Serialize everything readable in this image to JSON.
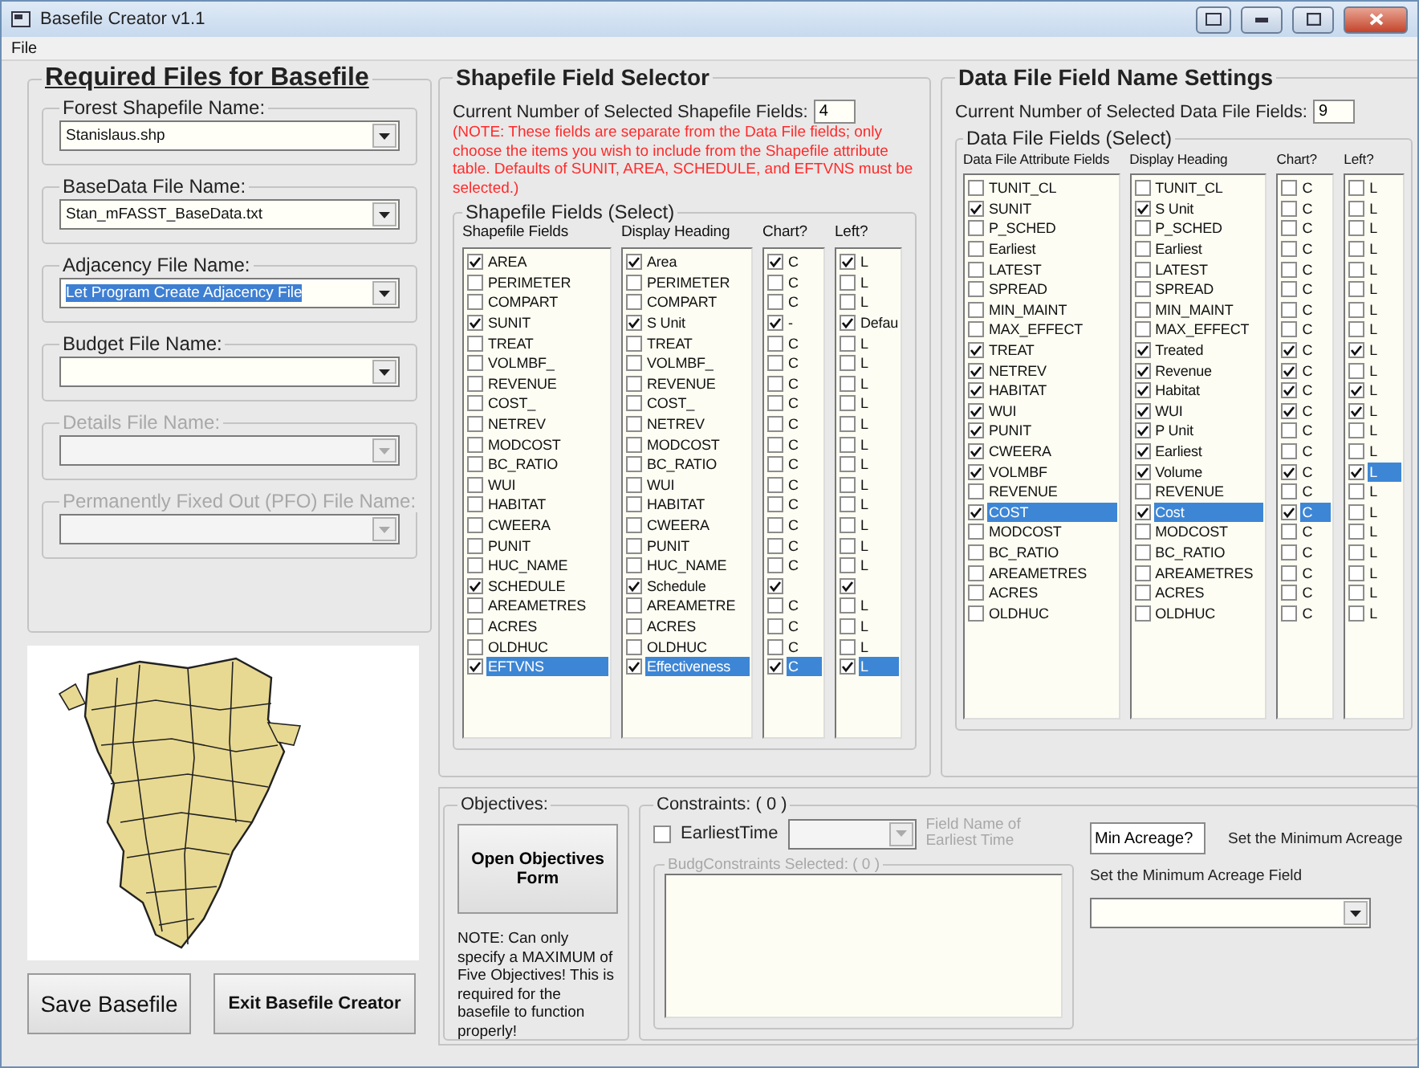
{
  "window": {
    "title": "Basefile Creator v1.1"
  },
  "menu": [
    "File"
  ],
  "required_files": {
    "title": "Required Files for Basefile",
    "fields": [
      {
        "label": "Forest Shapefile Name:",
        "value": "Stanislaus.shp",
        "disabled": false,
        "highlighted": false
      },
      {
        "label": "BaseData File Name:",
        "value": "Stan_mFASST_BaseData.txt",
        "disabled": false,
        "highlighted": false
      },
      {
        "label": "Adjacency File Name:",
        "value": "Let Program Create Adjacency File",
        "disabled": false,
        "highlighted": true
      },
      {
        "label": "Budget File Name:",
        "disabled": false
      },
      {
        "label": "Details File Name:",
        "disabled": true
      },
      {
        "label": "Permanently Fixed Out (PFO) File Name:",
        "disabled": true
      }
    ]
  },
  "buttons": [
    "Save Basefile",
    "Exit Basefile Creator"
  ],
  "shapefile_selector": {
    "title": "Shapefile Field Selector",
    "count_label": "Current Number of Selected Shapefile Fields:",
    "count": "4",
    "note": "(NOTE: These fields are separate from the Data File fields; only choose the items you wish to include from the Shapefile attribute table. Defaults of SUNIT, AREA, SCHEDULE, and EFTVNS must be selected.)",
    "group_title": "Shapefile Fields (Select)",
    "columns": [
      {
        "heading": "Shapefile Fields",
        "items": [
          {
            "text": "AREA",
            "checked": true,
            "selected": false
          },
          {
            "text": "PERIMETER",
            "checked": false,
            "selected": false
          },
          {
            "text": "COMPART",
            "checked": false,
            "selected": false
          },
          {
            "text": "SUNIT",
            "checked": true,
            "selected": false
          },
          {
            "text": "TREAT",
            "checked": false,
            "selected": false
          },
          {
            "text": "VOLMBF_",
            "checked": false,
            "selected": false
          },
          {
            "text": "REVENUE",
            "checked": false,
            "selected": false
          },
          {
            "text": "COST_",
            "checked": false,
            "selected": false
          },
          {
            "text": "NETREV",
            "checked": false,
            "selected": false
          },
          {
            "text": "MODCOST",
            "checked": false,
            "selected": false
          },
          {
            "text": "BC_RATIO",
            "checked": false,
            "selected": false
          },
          {
            "text": "WUI",
            "checked": false,
            "selected": false
          },
          {
            "text": "HABITAT",
            "checked": false,
            "selected": false
          },
          {
            "text": "CWEERA",
            "checked": false,
            "selected": false
          },
          {
            "text": "PUNIT",
            "checked": false,
            "selected": false
          },
          {
            "text": "HUC_NAME",
            "checked": false,
            "selected": false
          },
          {
            "text": "SCHEDULE",
            "checked": true,
            "selected": false
          },
          {
            "text": "AREAMETRES",
            "checked": false,
            "selected": false
          },
          {
            "text": "ACRES",
            "checked": false,
            "selected": false
          },
          {
            "text": "OLDHUC",
            "checked": false,
            "selected": false
          },
          {
            "text": "EFTVNS",
            "checked": true,
            "selected": true
          }
        ]
      },
      {
        "heading": "Display Heading",
        "items": [
          {
            "text": "Area",
            "checked": true,
            "selected": false
          },
          {
            "text": "PERIMETER",
            "checked": false,
            "selected": false
          },
          {
            "text": "COMPART",
            "checked": false,
            "selected": false
          },
          {
            "text": "S Unit",
            "checked": true,
            "selected": false
          },
          {
            "text": "TREAT",
            "checked": false,
            "selected": false
          },
          {
            "text": "VOLMBF_",
            "checked": false,
            "selected": false
          },
          {
            "text": "REVENUE",
            "checked": false,
            "selected": false
          },
          {
            "text": "COST_",
            "checked": false,
            "selected": false
          },
          {
            "text": "NETREV",
            "checked": false,
            "selected": false
          },
          {
            "text": "MODCOST",
            "checked": false,
            "selected": false
          },
          {
            "text": "BC_RATIO",
            "checked": false,
            "selected": false
          },
          {
            "text": "WUI",
            "checked": false,
            "selected": false
          },
          {
            "text": "HABITAT",
            "checked": false,
            "selected": false
          },
          {
            "text": "CWEERA",
            "checked": false,
            "selected": false
          },
          {
            "text": "PUNIT",
            "checked": false,
            "selected": false
          },
          {
            "text": "HUC_NAME",
            "checked": false,
            "selected": false
          },
          {
            "text": "Schedule",
            "checked": true,
            "selected": false
          },
          {
            "text": "AREAMETRE",
            "checked": false,
            "selected": false
          },
          {
            "text": "ACRES",
            "checked": false,
            "selected": false
          },
          {
            "text": "OLDHUC",
            "checked": false,
            "selected": false
          },
          {
            "text": "Effectiveness",
            "checked": true,
            "selected": true
          }
        ]
      },
      {
        "heading": "Chart?",
        "items": [
          {
            "text": "C",
            "checked": true,
            "selected": false
          },
          {
            "text": "C",
            "checked": false,
            "selected": false
          },
          {
            "text": "C",
            "checked": false,
            "selected": false
          },
          {
            "text": "-",
            "checked": true,
            "selected": false
          },
          {
            "text": "C",
            "checked": false,
            "selected": false
          },
          {
            "text": "C",
            "checked": false,
            "selected": false
          },
          {
            "text": "C",
            "checked": false,
            "selected": false
          },
          {
            "text": "C",
            "checked": false,
            "selected": false
          },
          {
            "text": "C",
            "checked": false,
            "selected": false
          },
          {
            "text": "C",
            "checked": false,
            "selected": false
          },
          {
            "text": "C",
            "checked": false,
            "selected": false
          },
          {
            "text": "C",
            "checked": false,
            "selected": false
          },
          {
            "text": "C",
            "checked": false,
            "selected": false
          },
          {
            "text": "C",
            "checked": false,
            "selected": false
          },
          {
            "text": "C",
            "checked": false,
            "selected": false
          },
          {
            "text": "C",
            "checked": false,
            "selected": false
          },
          {
            "checked": true
          },
          {
            "text": "C",
            "checked": false,
            "selected": false
          },
          {
            "text": "C",
            "checked": false,
            "selected": false
          },
          {
            "text": "C",
            "checked": false,
            "selected": false
          },
          {
            "text": "C",
            "checked": true,
            "selected": true
          }
        ]
      },
      {
        "heading": "Left?",
        "items": [
          {
            "text": "L",
            "checked": true,
            "selected": false
          },
          {
            "text": "L",
            "checked": false,
            "selected": false
          },
          {
            "text": "L",
            "checked": false,
            "selected": false
          },
          {
            "text": "Defau",
            "checked": true,
            "selected": false
          },
          {
            "text": "L",
            "checked": false,
            "selected": false
          },
          {
            "text": "L",
            "checked": false,
            "selected": false
          },
          {
            "text": "L",
            "checked": false,
            "selected": false
          },
          {
            "text": "L",
            "checked": false,
            "selected": false
          },
          {
            "text": "L",
            "checked": false,
            "selected": false
          },
          {
            "text": "L",
            "checked": false,
            "selected": false
          },
          {
            "text": "L",
            "checked": false,
            "selected": false
          },
          {
            "text": "L",
            "checked": false,
            "selected": false
          },
          {
            "text": "L",
            "checked": false,
            "selected": false
          },
          {
            "text": "L",
            "checked": false,
            "selected": false
          },
          {
            "text": "L",
            "checked": false,
            "selected": false
          },
          {
            "text": "L",
            "checked": false,
            "selected": false
          },
          {
            "checked": true
          },
          {
            "text": "L",
            "checked": false,
            "selected": false
          },
          {
            "text": "L",
            "checked": false,
            "selected": false
          },
          {
            "text": "L",
            "checked": false,
            "selected": false
          },
          {
            "text": "L",
            "checked": true,
            "selected": true
          }
        ]
      }
    ]
  },
  "data_file_settings": {
    "title": "Data File Field Name Settings",
    "count_label": "Current Number of Selected Data File Fields:",
    "count": "9",
    "group_title": "Data File Fields (Select)",
    "columns": [
      {
        "heading": "Data File Attribute Fields",
        "items": [
          {
            "text": "TUNIT_CL",
            "checked": false,
            "selected": false
          },
          {
            "text": "SUNIT",
            "checked": true,
            "selected": false
          },
          {
            "text": "P_SCHED",
            "checked": false,
            "selected": false
          },
          {
            "text": "Earliest",
            "checked": false,
            "selected": false
          },
          {
            "text": "LATEST",
            "checked": false,
            "selected": false
          },
          {
            "text": "SPREAD",
            "checked": false,
            "selected": false
          },
          {
            "text": "MIN_MAINT",
            "checked": false,
            "selected": false
          },
          {
            "text": "MAX_EFFECT",
            "checked": false,
            "selected": false
          },
          {
            "text": "TREAT",
            "checked": true,
            "selected": false
          },
          {
            "text": "NETREV",
            "checked": true,
            "selected": false
          },
          {
            "text": "HABITAT",
            "checked": true,
            "selected": false
          },
          {
            "text": "WUI",
            "checked": true,
            "selected": false
          },
          {
            "text": "PUNIT",
            "checked": true,
            "selected": false
          },
          {
            "text": "CWEERA",
            "checked": true,
            "selected": false
          },
          {
            "text": "VOLMBF",
            "checked": true,
            "selected": false
          },
          {
            "text": "REVENUE",
            "checked": false,
            "selected": false
          },
          {
            "text": "COST",
            "checked": true,
            "selected": true
          },
          {
            "text": "MODCOST",
            "checked": false,
            "selected": false
          },
          {
            "text": "BC_RATIO",
            "checked": false,
            "selected": false
          },
          {
            "text": "AREAMETRES",
            "checked": false,
            "selected": false
          },
          {
            "text": "ACRES",
            "checked": false,
            "selected": false
          },
          {
            "text": "OLDHUC",
            "checked": false,
            "selected": false
          }
        ]
      },
      {
        "heading": "Display Heading",
        "items": [
          {
            "text": "TUNIT_CL",
            "checked": false,
            "selected": false
          },
          {
            "text": "S Unit",
            "checked": true,
            "selected": false
          },
          {
            "text": "P_SCHED",
            "checked": false,
            "selected": false
          },
          {
            "text": "Earliest",
            "checked": false,
            "selected": false
          },
          {
            "text": "LATEST",
            "checked": false,
            "selected": false
          },
          {
            "text": "SPREAD",
            "checked": false,
            "selected": false
          },
          {
            "text": "MIN_MAINT",
            "checked": false,
            "selected": false
          },
          {
            "text": "MAX_EFFECT",
            "checked": false,
            "selected": false
          },
          {
            "text": "Treated",
            "checked": true,
            "selected": false
          },
          {
            "text": "Revenue",
            "checked": true,
            "selected": false
          },
          {
            "text": "Habitat",
            "checked": true,
            "selected": false
          },
          {
            "text": "WUI",
            "checked": true,
            "selected": false
          },
          {
            "text": "P Unit",
            "checked": true,
            "selected": false
          },
          {
            "text": "Earliest",
            "checked": true,
            "selected": false
          },
          {
            "text": "Volume",
            "checked": true,
            "selected": false
          },
          {
            "text": "REVENUE",
            "checked": false,
            "selected": false
          },
          {
            "text": "Cost",
            "checked": true,
            "selected": true
          },
          {
            "text": "MODCOST",
            "checked": false,
            "selected": false
          },
          {
            "text": "BC_RATIO",
            "checked": false,
            "selected": false
          },
          {
            "text": "AREAMETRES",
            "checked": false,
            "selected": false
          },
          {
            "text": "ACRES",
            "checked": false,
            "selected": false
          },
          {
            "text": "OLDHUC",
            "checked": false,
            "selected": false
          }
        ]
      },
      {
        "heading": "Chart?",
        "items": [
          {
            "text": "C",
            "checked": false,
            "selected": false
          },
          {
            "text": "C",
            "checked": false,
            "selected": false
          },
          {
            "text": "C",
            "checked": false,
            "selected": false
          },
          {
            "text": "C",
            "checked": false,
            "selected": false
          },
          {
            "text": "C",
            "checked": false,
            "selected": false
          },
          {
            "text": "C",
            "checked": false,
            "selected": false
          },
          {
            "text": "C",
            "checked": false,
            "selected": false
          },
          {
            "text": "C",
            "checked": false,
            "selected": false
          },
          {
            "text": "C",
            "checked": true,
            "selected": false
          },
          {
            "text": "C",
            "checked": true,
            "selected": false
          },
          {
            "text": "C",
            "checked": true,
            "selected": false
          },
          {
            "text": "C",
            "checked": true,
            "selected": false
          },
          {
            "text": "C",
            "checked": false,
            "selected": false
          },
          {
            "text": "C",
            "checked": false,
            "selected": false
          },
          {
            "text": "C",
            "checked": true,
            "selected": false
          },
          {
            "text": "C",
            "checked": false,
            "selected": false
          },
          {
            "text": "C",
            "checked": true,
            "selected": true
          },
          {
            "text": "C",
            "checked": false,
            "selected": false
          },
          {
            "text": "C",
            "checked": false,
            "selected": false
          },
          {
            "text": "C",
            "checked": false,
            "selected": false
          },
          {
            "text": "C",
            "checked": false,
            "selected": false
          },
          {
            "text": "C",
            "checked": false,
            "selected": false
          }
        ]
      },
      {
        "heading": "Left?",
        "items": [
          {
            "text": "L",
            "checked": false,
            "selected": false
          },
          {
            "text": "L",
            "checked": false,
            "selected": false
          },
          {
            "text": "L",
            "checked": false,
            "selected": false
          },
          {
            "text": "L",
            "checked": false,
            "selected": false
          },
          {
            "text": "L",
            "checked": false,
            "selected": false
          },
          {
            "text": "L",
            "checked": false,
            "selected": false
          },
          {
            "text": "L",
            "checked": false,
            "selected": false
          },
          {
            "text": "L",
            "checked": false,
            "selected": false
          },
          {
            "text": "L",
            "checked": true,
            "selected": false
          },
          {
            "text": "L",
            "checked": false,
            "selected": false
          },
          {
            "text": "L",
            "checked": true,
            "selected": false
          },
          {
            "text": "L",
            "checked": true,
            "selected": false
          },
          {
            "text": "L",
            "checked": false,
            "selected": false
          },
          {
            "text": "L",
            "checked": false,
            "selected": false
          },
          {
            "text": "L",
            "checked": true,
            "selected": true
          },
          {
            "text": "L",
            "checked": false,
            "selected": false
          },
          {
            "text": "L",
            "checked": false,
            "selected": false
          },
          {
            "text": "L",
            "checked": false,
            "selected": false
          },
          {
            "text": "L",
            "checked": false,
            "selected": false
          },
          {
            "text": "L",
            "checked": false,
            "selected": false
          },
          {
            "text": "L",
            "checked": false,
            "selected": false
          },
          {
            "text": "L",
            "checked": false,
            "selected": false
          }
        ]
      }
    ]
  },
  "objectives": {
    "title": "Objectives:",
    "button": "Open Objectives Form",
    "note": "NOTE: Can only specify a MAXIMUM of Five Objectives! This is required for the basefile to function properly!"
  },
  "constraints": {
    "title": "Constraints: ( 0 )",
    "earliest_time": {
      "label": "EarliestTime",
      "checked": false
    },
    "earliest_field": {
      "label": "Field Name of Earliest Time",
      "disabled": true
    },
    "budget_group": {
      "title": "BudgConstraints Selected: ( 0 )",
      "disabled": true
    },
    "min_acreage": {
      "value": "Min Acreage?",
      "label": "Set the Minimum Acreage"
    },
    "min_acreage_field": {
      "label": "Set the Minimum Acreage Field"
    }
  }
}
